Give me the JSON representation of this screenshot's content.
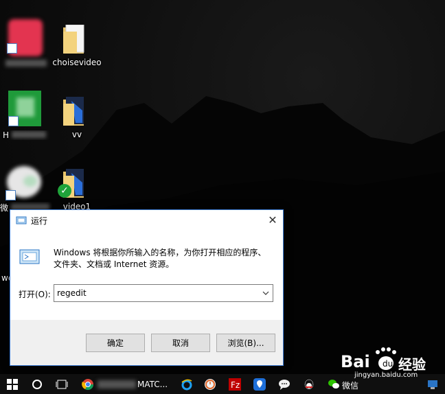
{
  "desktop": {
    "icons": [
      {
        "label": "",
        "kind": "app-red"
      },
      {
        "label": "choisevideo",
        "kind": "folder"
      },
      {
        "label": "H",
        "kind": "app-green"
      },
      {
        "label": "vv",
        "kind": "folder"
      },
      {
        "label": "微",
        "kind": "app-wechat"
      },
      {
        "label": "video1",
        "kind": "folder"
      },
      {
        "label": "we",
        "kind": "partial"
      }
    ]
  },
  "run_dialog": {
    "title": "运行",
    "description": "Windows 将根据你所输入的名称，为你打开相应的程序、文件夹、文档或 Internet 资源。",
    "open_label": "打开(O):",
    "input_value": "regedit",
    "ok_label": "确定",
    "cancel_label": "取消",
    "browse_label": "浏览(B)...",
    "close_glyph": "✕"
  },
  "taskbar": {
    "matlab_label": "MATC...",
    "wechat_label": "微信"
  },
  "watermark": {
    "brand": "Bai",
    "brand2": "经验",
    "url": "jingyan.baidu.com"
  },
  "colors": {
    "accent": "#3b7bd4",
    "dialog_bg": "#f0f0f0",
    "taskbar_bg": "#0f0f0f"
  }
}
